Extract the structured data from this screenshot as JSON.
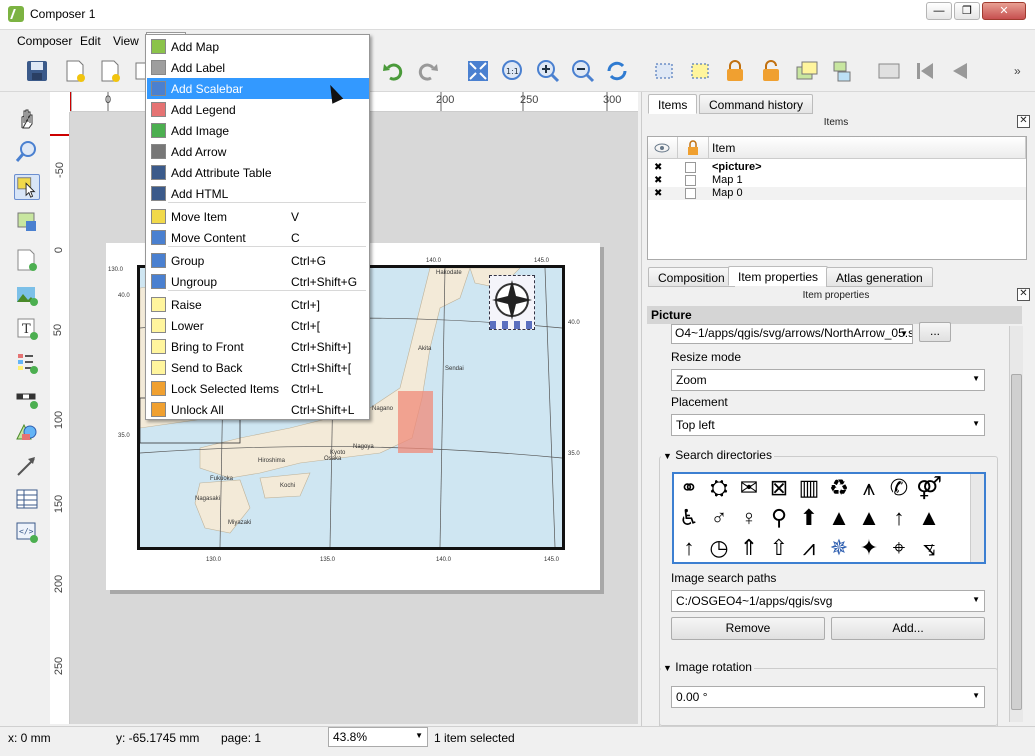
{
  "window": {
    "title": "Composer 1",
    "buttons": [
      "—",
      "❐",
      "✕"
    ]
  },
  "menubar": {
    "items": [
      "Composer",
      "Edit",
      "View"
    ]
  },
  "dropdown": {
    "items": [
      {
        "label": "Add Map",
        "shortcut": "",
        "icon": "add-map-icon"
      },
      {
        "label": "Add Label",
        "shortcut": "",
        "icon": "add-label-icon"
      },
      {
        "label": "Add Scalebar",
        "shortcut": "",
        "icon": "add-scalebar-icon",
        "highlighted": true
      },
      {
        "label": "Add Legend",
        "shortcut": "",
        "icon": "add-legend-icon"
      },
      {
        "label": "Add Image",
        "shortcut": "",
        "icon": "add-image-icon"
      },
      {
        "label": "Add Arrow",
        "shortcut": "",
        "icon": "add-arrow-icon"
      },
      {
        "label": "Add Attribute Table",
        "shortcut": "",
        "icon": "add-attribute-table-icon"
      },
      {
        "label": "Add HTML",
        "shortcut": "",
        "icon": "add-html-icon"
      },
      {
        "label": "Move Item",
        "shortcut": "V",
        "icon": "move-item-icon"
      },
      {
        "label": "Move Content",
        "shortcut": "C",
        "icon": "move-content-icon"
      },
      {
        "label": "Group",
        "shortcut": "Ctrl+G",
        "icon": "group-icon"
      },
      {
        "label": "Ungroup",
        "shortcut": "Ctrl+Shift+G",
        "icon": "ungroup-icon"
      },
      {
        "label": "Raise",
        "shortcut": "Ctrl+]",
        "icon": "raise-icon"
      },
      {
        "label": "Lower",
        "shortcut": "Ctrl+[",
        "icon": "lower-icon"
      },
      {
        "label": "Bring to Front",
        "shortcut": "Ctrl+Shift+]",
        "icon": "bring-to-front-icon"
      },
      {
        "label": "Send to Back",
        "shortcut": "Ctrl+Shift+[",
        "icon": "send-to-back-icon"
      },
      {
        "label": "Lock Selected Items",
        "shortcut": "Ctrl+L",
        "icon": "lock-icon"
      },
      {
        "label": "Unlock All",
        "shortcut": "Ctrl+Shift+L",
        "icon": "unlock-icon"
      }
    ]
  },
  "ruler": {
    "h_labels": [
      "0",
      "200",
      "250",
      "300"
    ],
    "v_labels": [
      "-50",
      "0",
      "50",
      "100",
      "150",
      "200",
      "250"
    ]
  },
  "map": {
    "cities": [
      "Hakodate",
      "Sendai",
      "Akita",
      "Nagano",
      "Nagoya",
      "Hiroshima",
      "Fukuoka",
      "Kochi",
      "Nagasaki",
      "Miyazaki",
      "Osaka",
      "Kyoto"
    ],
    "lat_labels": [
      "40.0",
      "35.0"
    ],
    "lon_labels": [
      "130.0",
      "135.0",
      "140.0",
      "145.0"
    ],
    "top_lon_labels": [
      "130.0",
      "140.0",
      "145.0"
    ]
  },
  "right_panel": {
    "top_tabs": [
      "Items",
      "Command history"
    ],
    "items_dock_title": "Items",
    "items_header": "Item",
    "items": [
      "<picture>",
      "Map 1",
      "Map 0"
    ],
    "prop_tabs": [
      "Composition",
      "Item properties",
      "Atlas generation"
    ],
    "props_dock_title": "Item properties",
    "picture_section": "Picture",
    "path_value": "O4~1/apps/qgis/svg/arrows/NorthArrow_05.svg",
    "path_button": "...",
    "resize_mode_label": "Resize mode",
    "resize_mode_value": "Zoom",
    "placement_label": "Placement",
    "placement_value": "Top left",
    "search_dirs_label": "Search directories",
    "image_search_paths_label": "Image search paths",
    "image_search_path_value": "C:/OSGEO4~1/apps/qgis/svg",
    "remove_button": "Remove",
    "add_button": "Add...",
    "image_rotation_label": "Image rotation",
    "rotation_value": "0.00 °"
  },
  "statusbar": {
    "x": "x: 0 mm",
    "y": "y: -65.1745 mm",
    "page": "page: 1",
    "zoom": "43.8%",
    "selection": "1 item selected"
  },
  "colors": {
    "highlight": "#3399ff",
    "water": "#cfe6f2",
    "land": "#f3ead8",
    "selected_map": "#f08a78"
  }
}
